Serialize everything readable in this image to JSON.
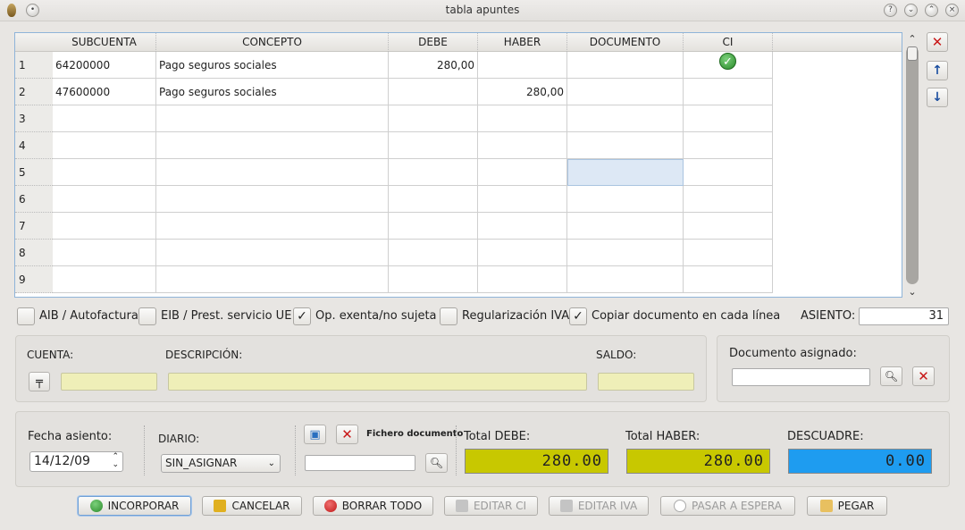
{
  "window": {
    "title": "tabla apuntes"
  },
  "table": {
    "headers": [
      "SUBCUENTA",
      "CONCEPTO",
      "DEBE",
      "HABER",
      "DOCUMENTO",
      "CI"
    ],
    "rows": [
      {
        "num": "1",
        "subcuenta": "64200000",
        "concepto": "Pago seguros sociales",
        "debe": "280,00",
        "haber": "",
        "documento": "",
        "ci": "check"
      },
      {
        "num": "2",
        "subcuenta": "47600000",
        "concepto": "Pago seguros sociales",
        "debe": "",
        "haber": "280,00",
        "documento": "",
        "ci": ""
      },
      {
        "num": "3",
        "subcuenta": "",
        "concepto": "",
        "debe": "",
        "haber": "",
        "documento": "",
        "ci": ""
      },
      {
        "num": "4",
        "subcuenta": "",
        "concepto": "",
        "debe": "",
        "haber": "",
        "documento": "",
        "ci": ""
      },
      {
        "num": "5",
        "subcuenta": "",
        "concepto": "",
        "debe": "",
        "haber": "",
        "documento": "",
        "ci": ""
      },
      {
        "num": "6",
        "subcuenta": "",
        "concepto": "",
        "debe": "",
        "haber": "",
        "documento": "",
        "ci": ""
      },
      {
        "num": "7",
        "subcuenta": "",
        "concepto": "",
        "debe": "",
        "haber": "",
        "documento": "",
        "ci": ""
      },
      {
        "num": "8",
        "subcuenta": "",
        "concepto": "",
        "debe": "",
        "haber": "",
        "documento": "",
        "ci": ""
      },
      {
        "num": "9",
        "subcuenta": "",
        "concepto": "",
        "debe": "",
        "haber": "",
        "documento": "",
        "ci": ""
      }
    ]
  },
  "options": {
    "aib": {
      "label": "AIB / Autofactura",
      "checked": false
    },
    "eib": {
      "label": "EIB / Prest. servicio UE",
      "checked": false
    },
    "exenta": {
      "label": "Op. exenta/no sujeta",
      "checked": true
    },
    "regularizacion": {
      "label": "Regularización IVA",
      "checked": false
    },
    "copiar": {
      "label": "Copiar documento en cada línea",
      "checked": true
    }
  },
  "asiento": {
    "label": "ASIENTO:",
    "value": "31"
  },
  "cuenta_group": {
    "cuenta_label": "CUENTA:",
    "descripcion_label": "DESCRIPCIÓN:",
    "saldo_label": "SALDO:"
  },
  "documento_group": {
    "label": "Documento asignado:"
  },
  "footer_group": {
    "fecha_label": "Fecha asiento:",
    "fecha_value": "14/12/09",
    "diario_label": "DIARIO:",
    "diario_value": "SIN_ASIGNAR",
    "fichero_label": "Fichero documento",
    "total_debe_label": "Total DEBE:",
    "total_debe_value": "280.00",
    "total_haber_label": "Total HABER:",
    "total_haber_value": "280.00",
    "descuadre_label": "DESCUADRE:",
    "descuadre_value": "0.00"
  },
  "colors": {
    "total_debe_bg": "#c8c800",
    "total_haber_bg": "#c8c800",
    "descuadre_bg": "#1e9cf0"
  },
  "buttons": {
    "incorporar": "INCORPORAR",
    "cancelar": "CANCELAR",
    "borrar_todo": "BORRAR TODO",
    "editar_ci": "EDITAR CI",
    "editar_iva": "EDITAR IVA",
    "pasar_espera": "PASAR A ESPERA",
    "pegar": "PEGAR"
  }
}
